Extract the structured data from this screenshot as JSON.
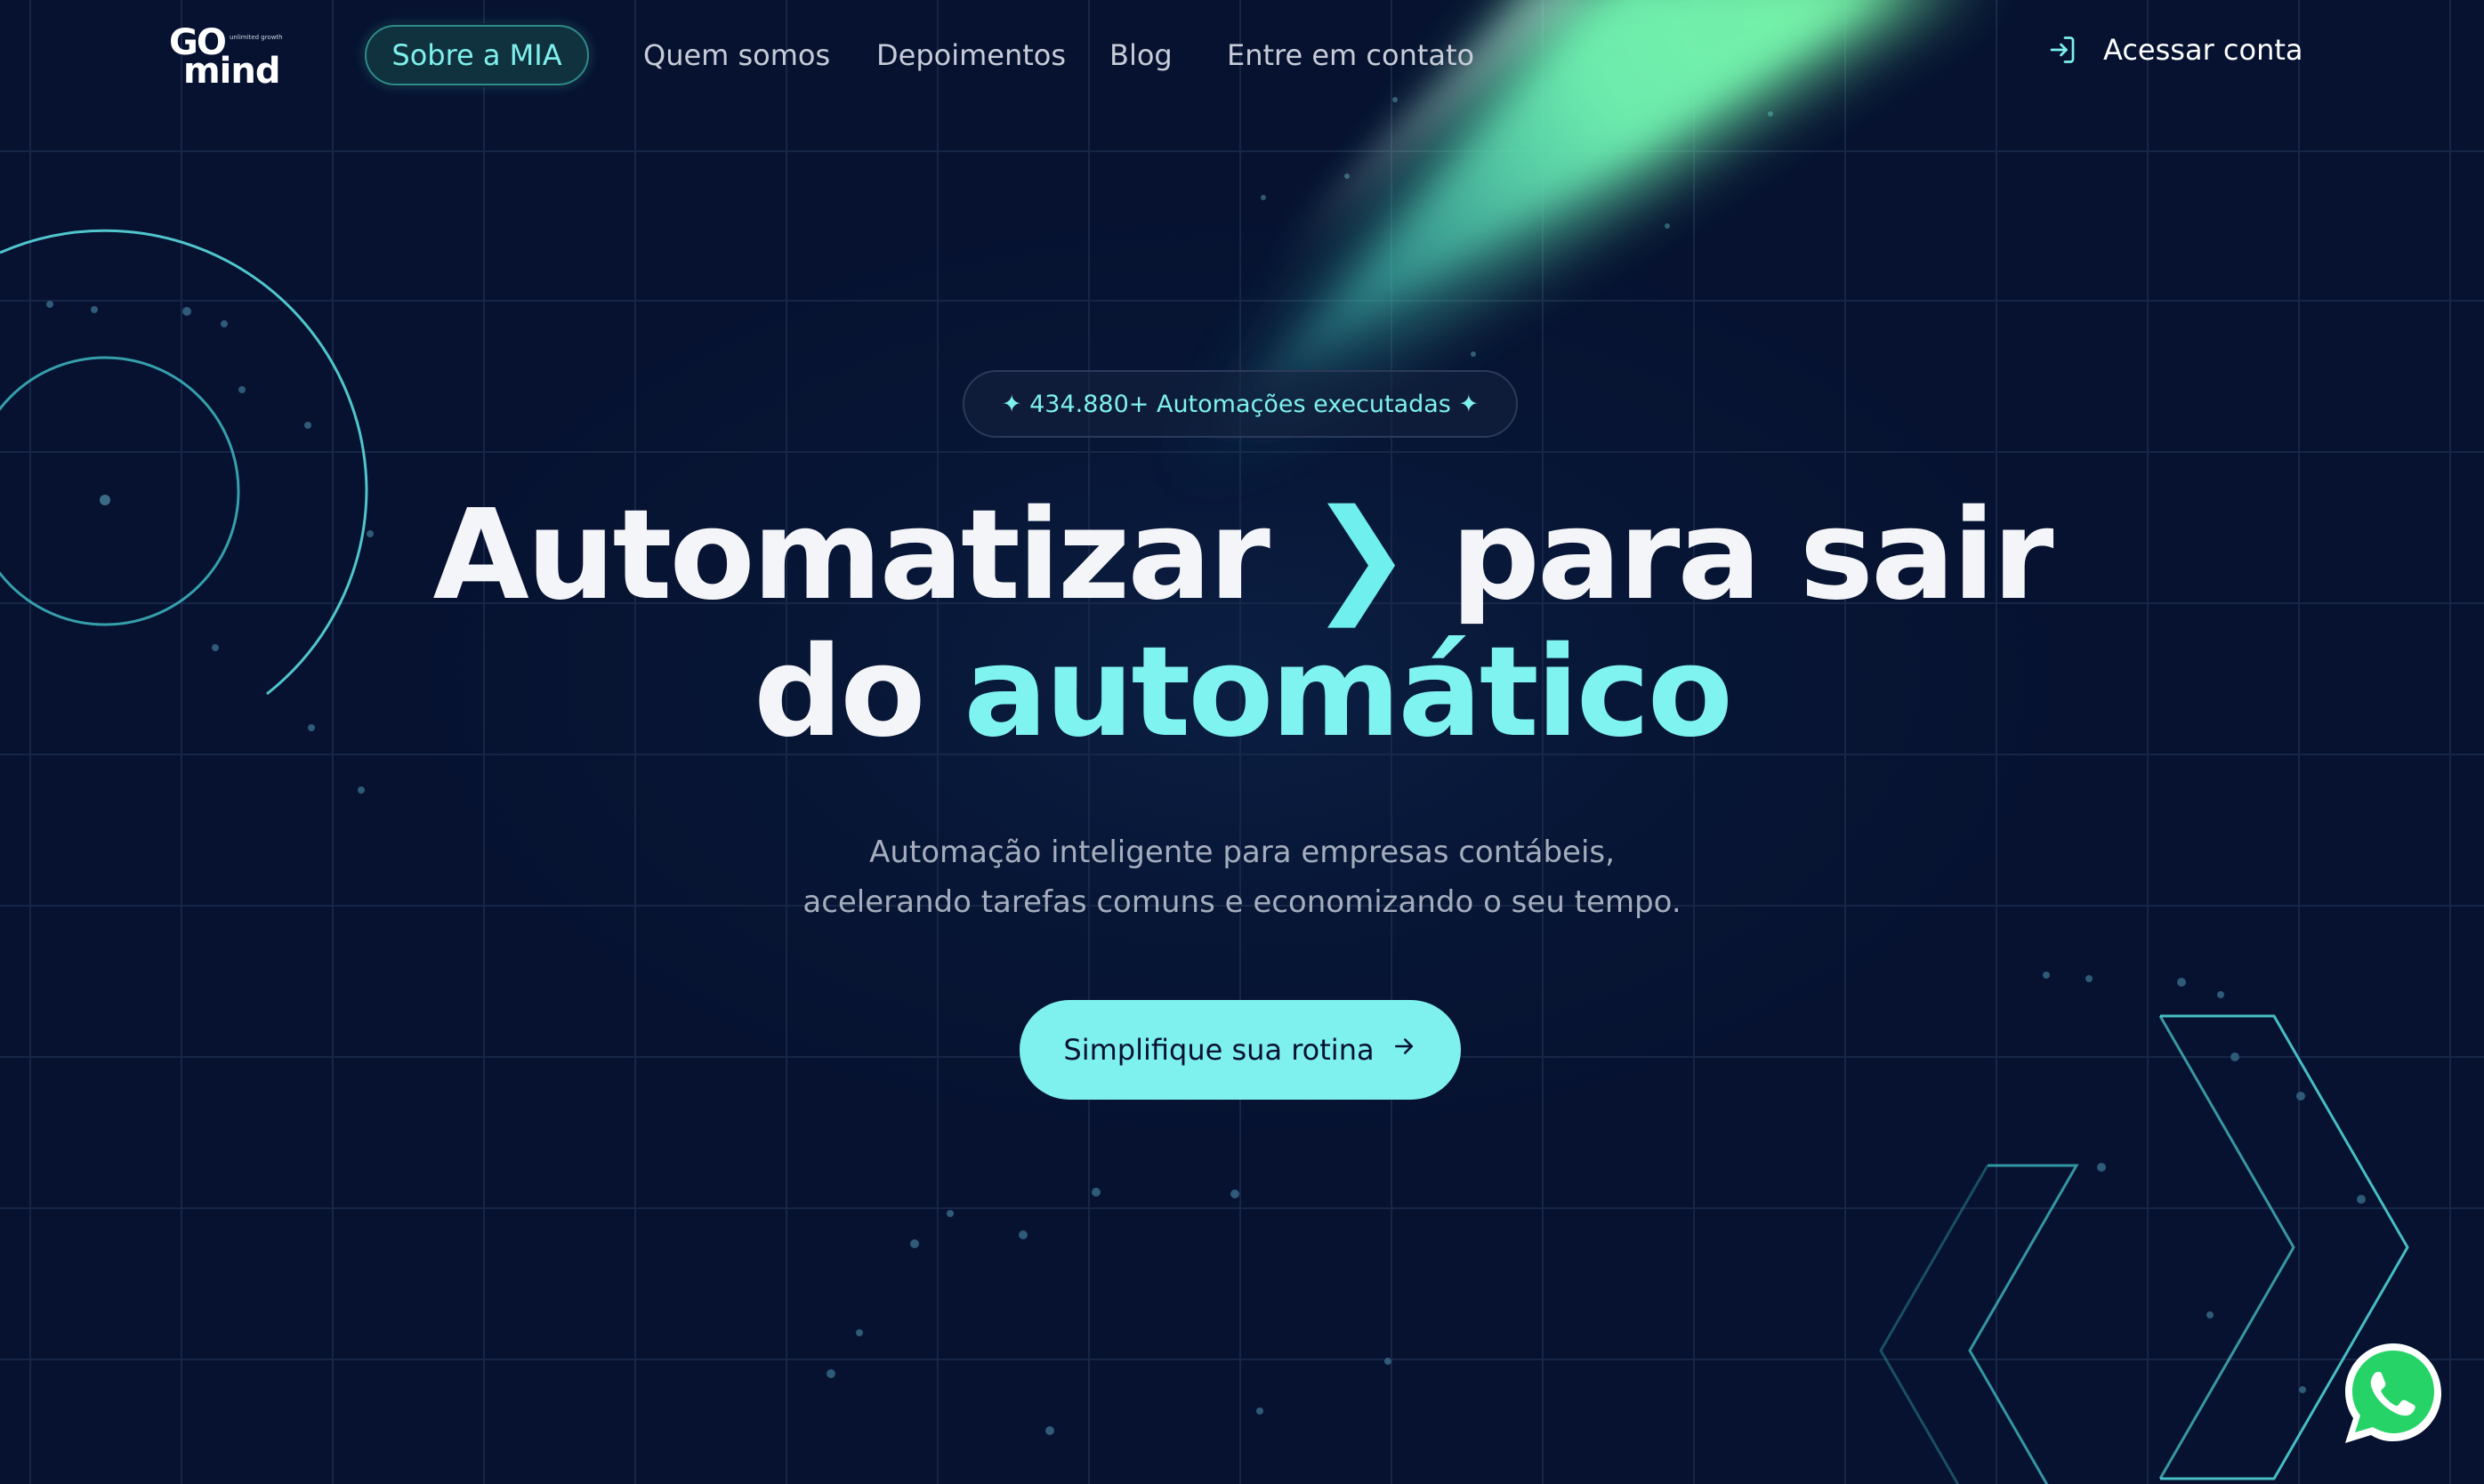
{
  "logo": {
    "top": "GO",
    "bottom": "mind",
    "tagline": "unlimited growth"
  },
  "nav": {
    "items": [
      {
        "label": "Sobre a MIA"
      },
      {
        "label": "Quem somos"
      },
      {
        "label": "Depoimentos"
      },
      {
        "label": "Blog"
      },
      {
        "label": "Entre em contato"
      }
    ],
    "login_label": "Acessar conta",
    "login_icon": "login-icon"
  },
  "hero": {
    "badge": "✦ 434.880+ Automações executadas ✦",
    "headline_part1": "Automatizar",
    "headline_chevron": "❯",
    "headline_part2": "para sair",
    "headline_part3": "do",
    "headline_accent": "automático",
    "subtitle_line1": "Automação inteligente para empresas contábeis,",
    "subtitle_line2": "acelerando tarefas comuns e economizando o seu tempo.",
    "cta_label": "Simplifique sua rotina",
    "cta_icon": "arrow-right-icon"
  },
  "floating": {
    "whatsapp_icon": "whatsapp-icon"
  },
  "colors": {
    "background": "#061230",
    "accent": "#7ef1ee",
    "beam": "#6ff0b0",
    "whatsapp": "#25d366"
  }
}
